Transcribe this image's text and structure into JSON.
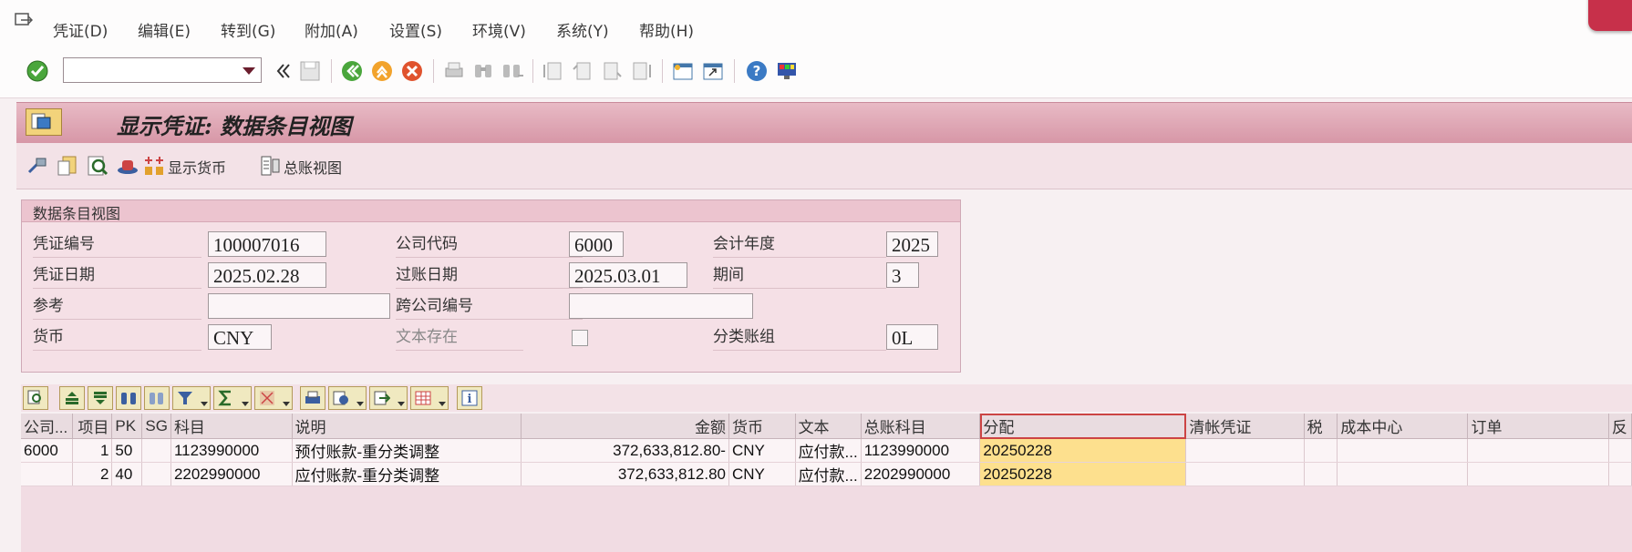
{
  "menubar": {
    "items": [
      "凭证(D)",
      "编辑(E)",
      "转到(G)",
      "附加(A)",
      "设置(S)",
      "环境(V)",
      "系统(Y)",
      "帮助(H)"
    ]
  },
  "toolbar": {
    "command_value": "",
    "icons": [
      "enter-icon",
      "back-icon",
      "save-icon",
      "back-green-icon",
      "exit-icon",
      "cancel-icon",
      "print-icon",
      "find-icon",
      "find-next-icon",
      "first-page-icon",
      "prev-page-icon",
      "next-page-icon",
      "last-page-icon",
      "new-session-icon",
      "shortcut-icon",
      "help-icon",
      "layout-icon"
    ]
  },
  "title": "显示凭证: 数据条目视图",
  "app_toolbar": {
    "show_currency_label": "显示货币",
    "gl_view_label": "总账视图"
  },
  "header_group": {
    "title": "数据条目视图",
    "fields": {
      "doc_number_label": "凭证编号",
      "doc_number": "100007016",
      "company_code_label": "公司代码",
      "company_code": "6000",
      "fiscal_year_label": "会计年度",
      "fiscal_year": "2025",
      "doc_date_label": "凭证日期",
      "doc_date": "2025.02.28",
      "posting_date_label": "过账日期",
      "posting_date": "2025.03.01",
      "period_label": "期间",
      "period": "3",
      "reference_label": "参考",
      "reference": "",
      "cross_company_label": "跨公司编号",
      "cross_company": "",
      "currency_label": "货币",
      "currency": "CNY",
      "text_exists_label": "文本存在",
      "ledger_group_label": "分类账组",
      "ledger_group": "0L"
    }
  },
  "grid": {
    "columns": [
      "公司...",
      "项目",
      "PK",
      "SG",
      "科目",
      "说明",
      "金额",
      "货币",
      "文本",
      "总账科目",
      "分配",
      "清帐凭证",
      "税",
      "成本中心",
      "订单",
      "反"
    ],
    "rows": [
      {
        "company": "6000",
        "item": "1",
        "pk": "50",
        "sg": "",
        "account": "1123990000",
        "desc": "预付账款-重分类调整",
        "amount": "372,633,812.80-",
        "currency": "CNY",
        "text": "应付款...",
        "gl": "1123990000",
        "assignment": "20250228",
        "clearing": "",
        "tax": "",
        "cost_center": "",
        "order": "",
        "rev": ""
      },
      {
        "company": "",
        "item": "2",
        "pk": "40",
        "sg": "",
        "account": "2202990000",
        "desc": "应付账款-重分类调整",
        "amount": "372,633,812.80",
        "currency": "CNY",
        "text": "应付款...",
        "gl": "2202990000",
        "assignment": "20250228",
        "clearing": "",
        "tax": "",
        "cost_center": "",
        "order": "",
        "rev": ""
      }
    ]
  },
  "colors": {
    "title_bar": "#d797a7",
    "highlight": "#fde08e",
    "close": "#c7304a"
  }
}
